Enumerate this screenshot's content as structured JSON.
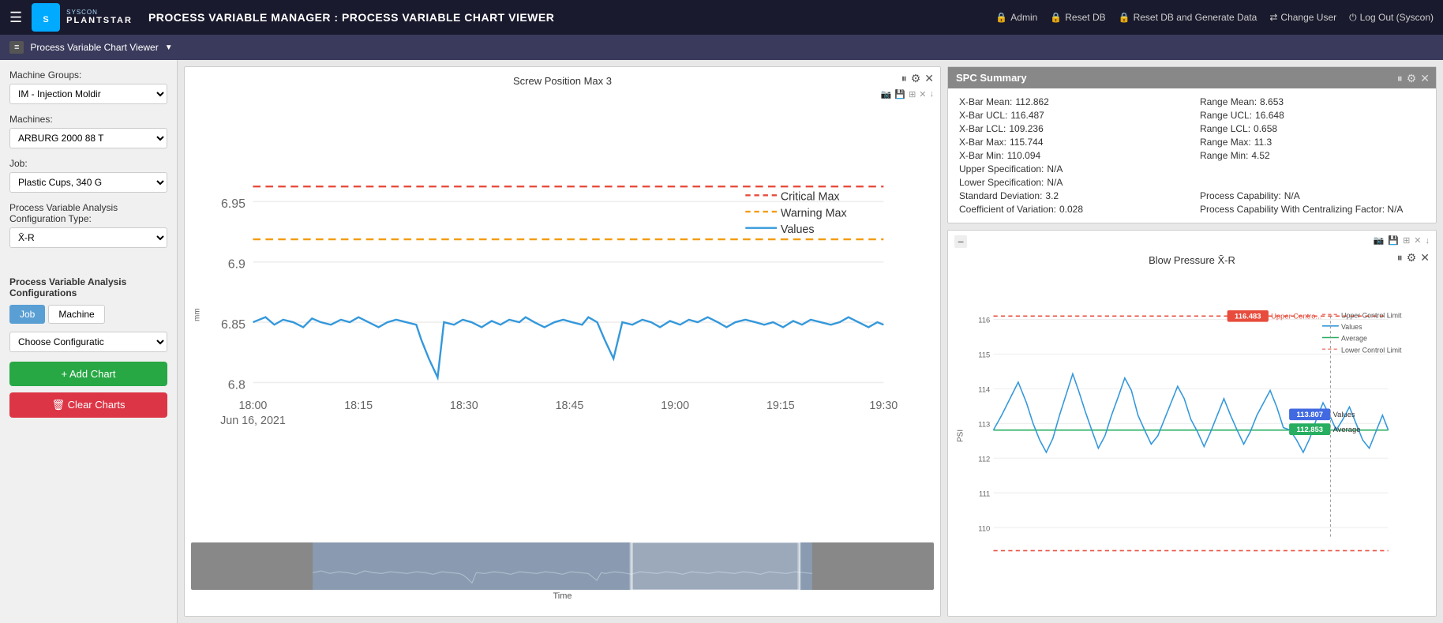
{
  "header": {
    "hamburger": "☰",
    "logo_text": "SYSCON\nPLANTSTAR",
    "title": "PROCESS VARIABLE MANAGER : PROCESS VARIABLE CHART VIEWER",
    "actions": [
      {
        "label": "Admin",
        "icon": "lock"
      },
      {
        "label": "Reset DB",
        "icon": "lock"
      },
      {
        "label": "Reset DB and Generate Data",
        "icon": "lock"
      },
      {
        "label": "Change User",
        "icon": "arrows"
      },
      {
        "label": "Log Out (Syscon)",
        "icon": "logout"
      }
    ]
  },
  "subheader": {
    "icon": "≡",
    "title": "Process Variable Chart Viewer",
    "chevron": "▼"
  },
  "sidebar": {
    "machine_groups_label": "Machine Groups:",
    "machine_groups_value": "IM - Injection Moldir",
    "machines_label": "Machines:",
    "machines_value": "ARBURG 2000 88 T",
    "job_label": "Job:",
    "job_value": "Plastic Cups, 340 G",
    "pv_analysis_label": "Process Variable Analysis Configuration Type:",
    "pv_analysis_value": "X̄-R",
    "pva_section_title": "Process Variable Analysis Configurations",
    "tab_job": "Job",
    "tab_machine": "Machine",
    "choose_config_placeholder": "Choose Configuratic",
    "add_chart_label": "+ Add Chart",
    "clear_charts_label": "🗑 Clear Charts"
  },
  "chart1": {
    "title": "Screw Position Max 3",
    "legend": {
      "critical_max": "Critical Max",
      "warning_max": "Warning Max",
      "values": "Values"
    },
    "y_axis_label": "mm",
    "y_values": [
      "6.95",
      "6.9",
      "6.85",
      "6.8"
    ],
    "x_labels": [
      "18:00",
      "18:15",
      "18:30",
      "18:45",
      "19:00",
      "19:15",
      "19:30"
    ],
    "x_date": "Jun 16, 2021",
    "navigator_label": "Time",
    "controls": [
      "⏸",
      "⚙",
      "✕"
    ]
  },
  "spc_summary": {
    "header": "SPC Summary",
    "items": [
      {
        "label": "X-Bar Mean:",
        "value": "112.862"
      },
      {
        "label": "Range Mean:",
        "value": "8.653"
      },
      {
        "label": "X-Bar UCL:",
        "value": "116.487"
      },
      {
        "label": "Range UCL:",
        "value": "16.648"
      },
      {
        "label": "X-Bar LCL:",
        "value": "109.236"
      },
      {
        "label": "Range LCL:",
        "value": "0.658"
      },
      {
        "label": "X-Bar Max:",
        "value": "115.744"
      },
      {
        "label": "Range Max:",
        "value": "11.3"
      },
      {
        "label": "X-Bar Min:",
        "value": "110.094"
      },
      {
        "label": "Range Min:",
        "value": "4.52"
      },
      {
        "label": "Upper Specification:",
        "value": "N/A"
      },
      {
        "label": "",
        "value": ""
      },
      {
        "label": "Lower Specification:",
        "value": "N/A"
      },
      {
        "label": "",
        "value": ""
      },
      {
        "label": "Standard Deviation:",
        "value": "3.2"
      },
      {
        "label": "Process Capability:",
        "value": "N/A"
      },
      {
        "label": "Coefficient of Variation:",
        "value": "0.028"
      },
      {
        "label": "Process Capability With Centralizing Factor:",
        "value": "N/A"
      }
    ]
  },
  "chart2": {
    "title": "Blow Pressure X̄-R",
    "y_axis_label": "PSI",
    "y_values": [
      "116",
      "115",
      "114",
      "113",
      "112",
      "111",
      "110"
    ],
    "legend": {
      "upper_control": "Upper Control Limit",
      "values": "Values",
      "average": "Average",
      "lower_control": "Lower Control Limit"
    },
    "tooltip_values": "113.807",
    "tooltip_average": "112.853",
    "tooltip_ucl": "116.483",
    "tooltip_ucl_label": "Upper Contro...",
    "controls": [
      "⏸",
      "⚙",
      "✕"
    ]
  },
  "colors": {
    "critical_max": "#e74c3c",
    "warning_max": "#f39c12",
    "values_line": "#3498db",
    "average_line": "#27ae60",
    "ucl_line": "#e74c3c",
    "lcl_line": "#e74c3c"
  }
}
